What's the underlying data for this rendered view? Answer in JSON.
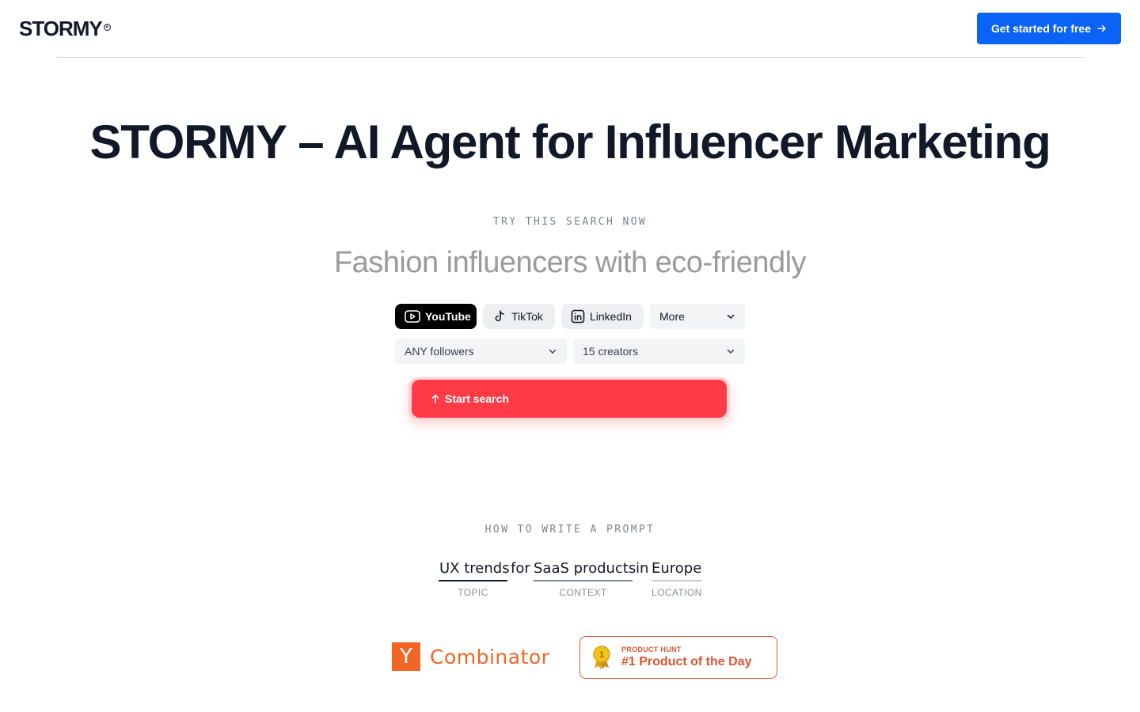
{
  "header": {
    "logo": "STORMY",
    "logo_mark": "®",
    "cta_label": "Get started for free"
  },
  "hero": {
    "title": "STORMY – AI Agent for Influencer Marketing",
    "try_label": "TRY THIS SEARCH NOW",
    "prompt": "Fashion influencers with eco-friendly"
  },
  "platforms": [
    {
      "label": "YouTube",
      "icon": "youtube-icon",
      "active": true
    },
    {
      "label": "TikTok",
      "icon": "tiktok-icon",
      "active": false
    },
    {
      "label": "LinkedIn",
      "icon": "linkedin-icon",
      "active": false
    }
  ],
  "more_select": "More",
  "filters": {
    "followers": "ANY followers",
    "creators": "15 creators"
  },
  "start_label": "Start search",
  "how": {
    "label": "HOW TO WRITE A PROMPT",
    "topic": "UX trends",
    "for": "for",
    "context": "SaaS products",
    "in": "in",
    "location": "Europe",
    "topic_caption": "TOPIC",
    "context_caption": "CONTEXT",
    "location_caption": "LOCATION"
  },
  "badges": {
    "yc_letter": "Y",
    "yc_text": "Combinator",
    "ph_small": "PRODUCT HUNT",
    "ph_big": "#1 Product of the Day",
    "ph_medal": "1"
  },
  "colors": {
    "cta": "#0b63f5",
    "start": "#ff3b47",
    "yc": "#f26625",
    "producthunt": "#da552f"
  }
}
